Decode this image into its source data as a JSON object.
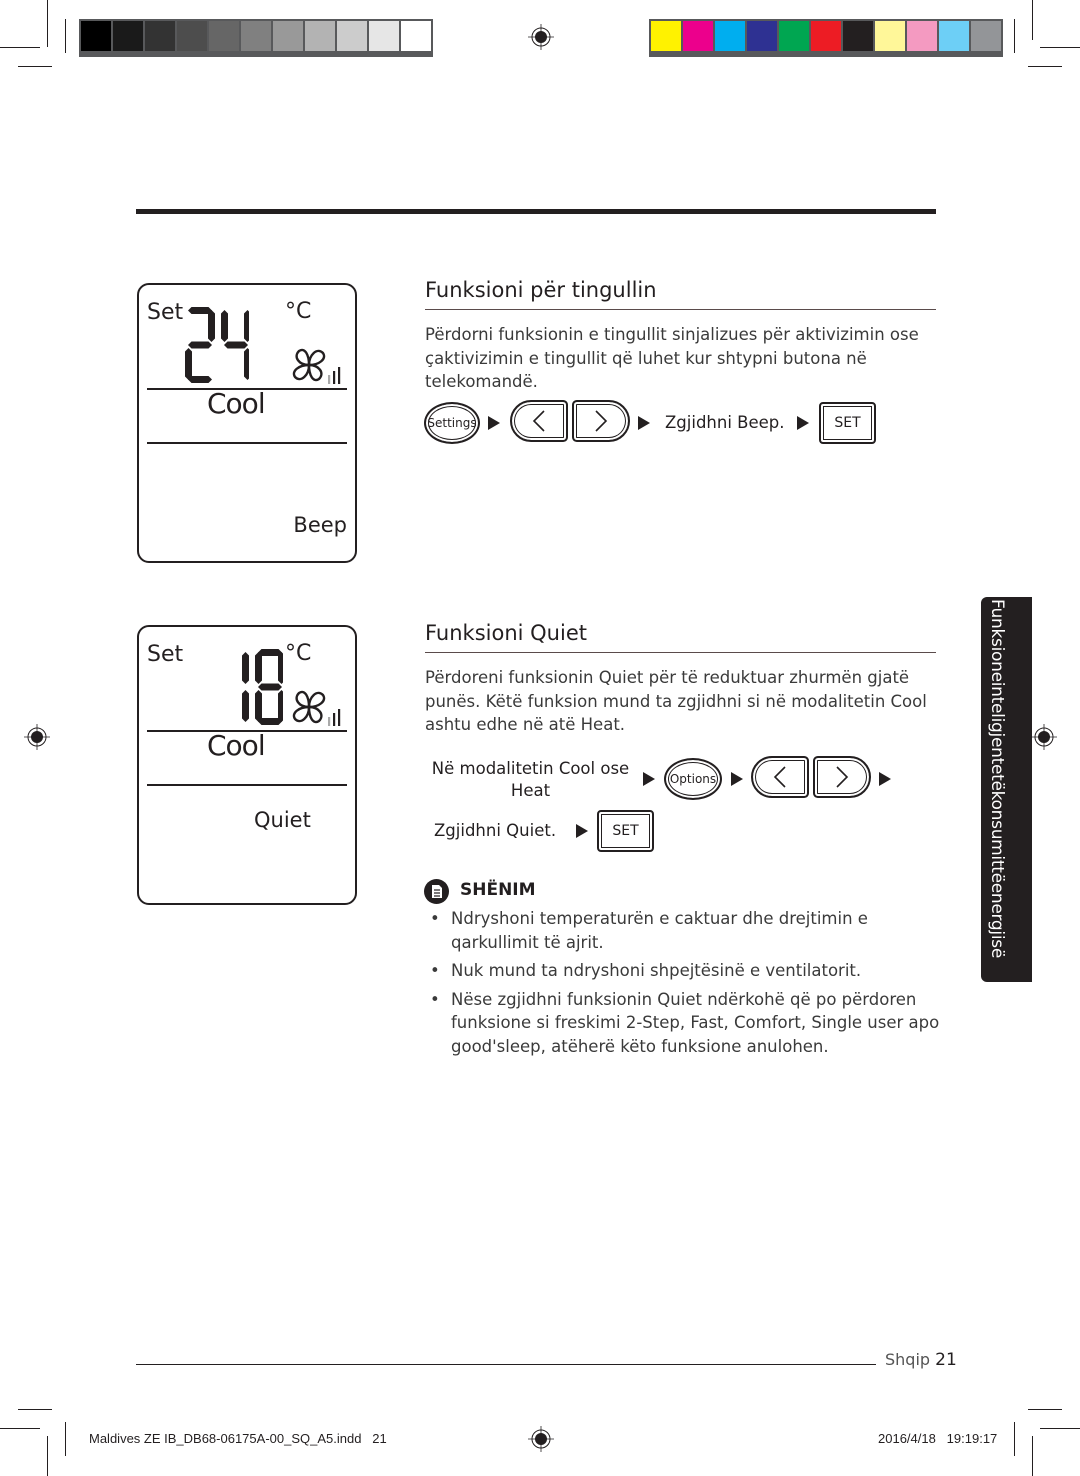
{
  "color_bars": {
    "grayscale": [
      "#000000",
      "#1a1a1a",
      "#333333",
      "#4d4d4d",
      "#666666",
      "#808080",
      "#999999",
      "#b3b3b3",
      "#cccccc",
      "#e6e6e6",
      "#ffffff"
    ],
    "process": [
      "#fff200",
      "#ec008c",
      "#00aeef",
      "#2e3192",
      "#00a651",
      "#ed1c24",
      "#231f20",
      "#fff799",
      "#f49ac1",
      "#6dcff6",
      "#939598"
    ]
  },
  "section_tab": {
    "label": "Funksioneinteligjentetëkonsumittëenergjisë"
  },
  "beep_section": {
    "lcd": {
      "set_label": "Set",
      "temperature": "24",
      "unit": "°C",
      "mode": "Cool",
      "function": "Beep"
    },
    "title": "Funksioni për tingullin",
    "description": "Përdorni funksionin e tingullit sinjalizues për aktivizimin ose çaktivizimin e tingullit që luhet kur shtypni butona në telekomandë.",
    "steps": {
      "settings_button": "Settings",
      "left_button": "<",
      "right_button": ">",
      "select_text": "Zgjidhni Beep.",
      "set_button": "SET"
    }
  },
  "quiet_section": {
    "lcd": {
      "set_label": "Set",
      "temperature": "18",
      "unit": "°C",
      "mode": "Cool",
      "function": "Quiet"
    },
    "title": "Funksioni Quiet",
    "description": "Përdoreni funksionin Quiet për të reduktuar zhurmën gjatë punës. Këtë funksion mund ta zgjidhni si në modalitetin Cool ashtu edhe në atë Heat.",
    "steps": {
      "condition_line1": "Në modalitetin Cool ose",
      "condition_line2": "Heat",
      "options_button": "Options",
      "left_button": "<",
      "right_button": ">",
      "select_text": "Zgjidhni Quiet.",
      "set_button": "SET"
    },
    "note": {
      "title": "SHËNIM",
      "items": [
        "Ndryshoni temperaturën e caktuar dhe drejtimin e qarkullimit të ajrit.",
        "Nuk mund ta ndryshoni shpejtësinë e ventilatorit.",
        "Nëse zgjidhni funksionin Quiet ndërkohë që po përdoren funksione si freskimi 2-Step, Fast, Comfort, Single user apo good'sleep, atëherë këto funksione anulohen."
      ]
    }
  },
  "footer": {
    "language": "Shqip",
    "page": "21"
  },
  "slug": {
    "file": "Maldives ZE IB_DB68-06175A-00_SQ_A5.indd   21",
    "datetime": "2016/4/18   19:19:17"
  }
}
